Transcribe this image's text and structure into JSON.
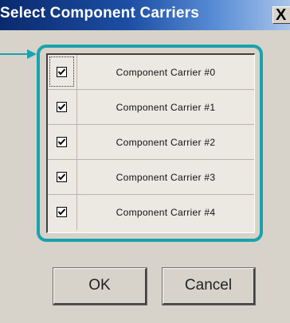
{
  "window": {
    "title": "Select Component Carriers",
    "close_glyph": "X"
  },
  "annotation": {
    "arrow_color": "#1aa3ad",
    "highlight_color": "#1aa3ad"
  },
  "carriers": [
    {
      "label": "Component Carrier #0",
      "checked": true
    },
    {
      "label": "Component Carrier #1",
      "checked": true
    },
    {
      "label": "Component Carrier #2",
      "checked": true
    },
    {
      "label": "Component Carrier #3",
      "checked": true
    },
    {
      "label": "Component Carrier #4",
      "checked": true
    }
  ],
  "buttons": {
    "ok": "OK",
    "cancel": "Cancel"
  }
}
